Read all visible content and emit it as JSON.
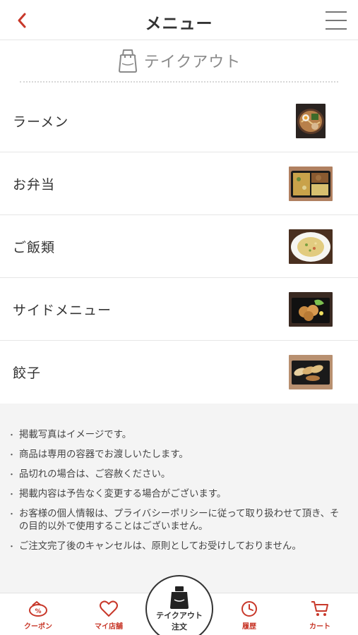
{
  "header": {
    "title": "メニュー"
  },
  "section": {
    "label": "テイクアウト"
  },
  "categories": [
    {
      "label": "ラーメン",
      "thumb": "ramen"
    },
    {
      "label": "お弁当",
      "thumb": "bento"
    },
    {
      "label": "ご飯類",
      "thumb": "rice"
    },
    {
      "label": "サイドメニュー",
      "thumb": "side"
    },
    {
      "label": "餃子",
      "thumb": "gyoza"
    }
  ],
  "notes": [
    "掲載写真はイメージです。",
    "商品は専用の容器でお渡しいたします。",
    "品切れの場合は、ご容赦ください。",
    "掲載内容は予告なく変更する場合がございます。",
    "お客様の個人情報は、プライバシーポリシーに従って取り扱わせて頂き、その目的以外で使用することはございません。",
    "ご注文完了後のキャンセルは、原則としてお受けしておりません。"
  ],
  "bottom_nav": {
    "coupon": "クーポン",
    "my_store": "マイ店舗",
    "takeout_line1": "テイクアウト",
    "takeout_line2": "注文",
    "history": "履歴",
    "cart": "カート"
  },
  "colors": {
    "accent": "#c8382a",
    "text": "#333333",
    "muted": "#8a8a8a",
    "notes_bg": "#f4f4f4"
  }
}
